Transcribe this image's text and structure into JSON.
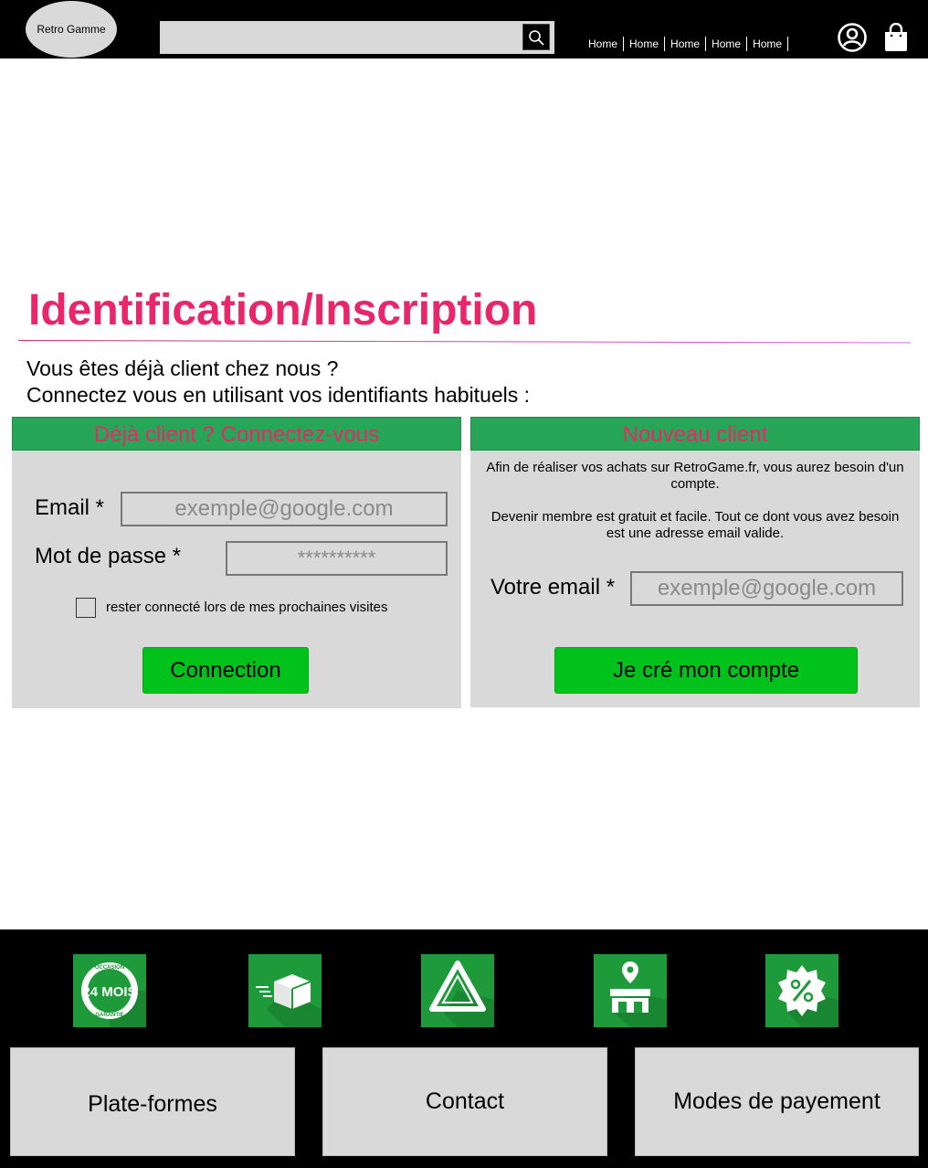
{
  "header": {
    "logo": "Retro Gamme",
    "search_placeholder": "",
    "nav": [
      "Home",
      "Home",
      "Home",
      "Home",
      "Home"
    ]
  },
  "main": {
    "title": "Identification/Inscription",
    "intro_line1": "Vous êtes déjà client chez nous ?",
    "intro_line2": "Connectez vous en utilisant vos identifiants habituels :"
  },
  "login": {
    "heading": "Déjà client ? Connectez-vous",
    "email_label": "Email *",
    "email_placeholder": "exemple@google.com",
    "password_label": "Mot de passe *",
    "password_placeholder": "**********",
    "remember_label": "rester connecté lors de mes prochaines visites",
    "submit_label": "Connection"
  },
  "signup": {
    "heading": "Nouveau client",
    "info1": "Afin de réaliser vos achats sur RetroGame.fr, vous aurez besoin d'un compte.",
    "info2": "Devenir membre est gratuit et facile. Tout ce dont vous avez besoin est une adresse email valide.",
    "email_label": "Votre email *",
    "email_placeholder": "exemple@google.com",
    "submit_label": "Je cré mon compte"
  },
  "footer": {
    "badge_line1": "OCCASION",
    "badge_main": "24 MOIS",
    "badge_line2": "GARANTIE",
    "links": [
      "Plate-formes",
      "Contact",
      "Modes de payement"
    ]
  },
  "colors": {
    "accent": "#e8266a",
    "panel_header": "#27a658",
    "button_green": "#00c21b",
    "icon_green": "#1f9a3a"
  }
}
